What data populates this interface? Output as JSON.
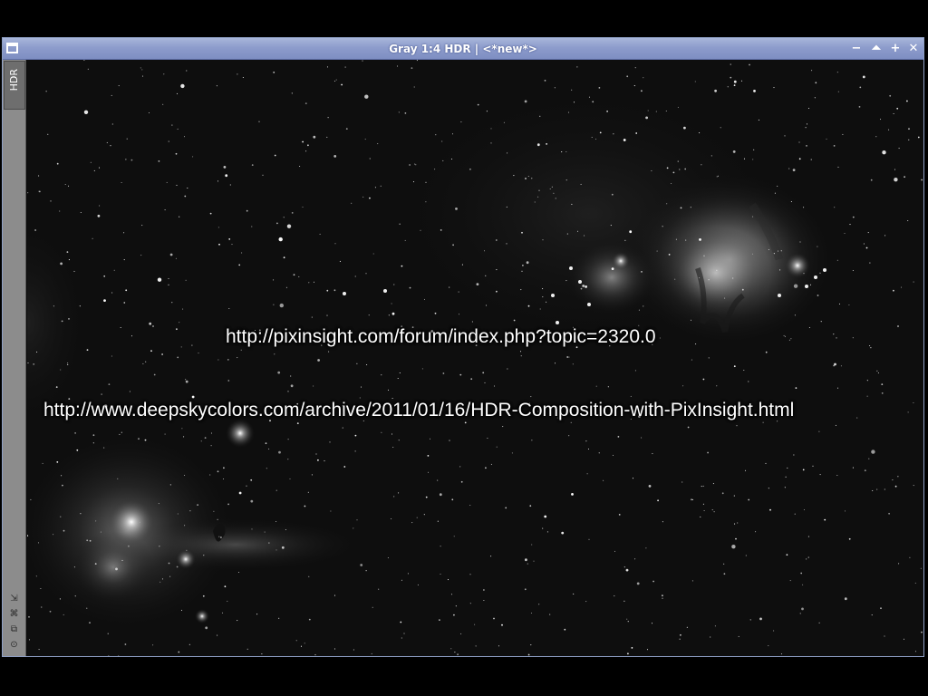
{
  "window": {
    "title": "Gray 1:4 HDR | <*new*>",
    "icon": "window-system-icon",
    "title_color": "#8d9ccc",
    "buttons": [
      {
        "name": "minimize",
        "glyph": "−"
      },
      {
        "name": "shade",
        "glyph": "⏶"
      },
      {
        "name": "maximize",
        "glyph": "+"
      },
      {
        "name": "close",
        "glyph": "✕"
      }
    ]
  },
  "sidebar": {
    "tab_label": "HDR",
    "tools": [
      {
        "name": "zoom-fit-icon",
        "glyph": "⇲"
      },
      {
        "name": "pin-icon",
        "glyph": "⌘"
      },
      {
        "name": "clone-icon",
        "glyph": "⧉"
      },
      {
        "name": "target-icon",
        "glyph": "⊙"
      }
    ]
  },
  "image": {
    "description_kind": "astrophotograph-grayscale",
    "overlay_links": [
      "http://pixinsight.com/forum/index.php?topic=2320.0",
      "http://www.deepskycolors.com/archive/2011/01/16/HDR-Composition-with-PixInsight.html"
    ]
  }
}
